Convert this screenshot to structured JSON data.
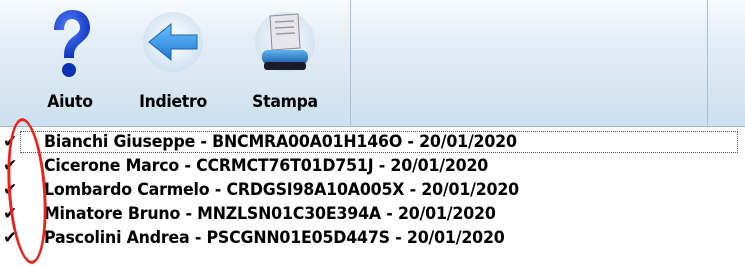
{
  "toolbar": {
    "help_label": "Aiuto",
    "back_label": "Indietro",
    "print_label": "Stampa"
  },
  "list": {
    "items": [
      {
        "checked": true,
        "label": "Bianchi Giuseppe - BNCMRA00A01H146O - 20/01/2020"
      },
      {
        "checked": true,
        "label": "Cicerone Marco - CCRMCT76T01D751J - 20/01/2020"
      },
      {
        "checked": true,
        "label": "Lombardo Carmelo - CRDGSI98A10A005X - 20/01/2020"
      },
      {
        "checked": true,
        "label": "Minatore Bruno - MNZLSN01C30E394A - 20/01/2020"
      },
      {
        "checked": true,
        "label": "Pascolini Andrea - PSCGNN01E05D447S - 20/01/2020"
      }
    ]
  },
  "check_glyph": "✔",
  "colors": {
    "annotation": "#e8231d",
    "toolbar_bg": "#cde0ee",
    "help_icon": "#1e4bd6",
    "back_icon": "#2a8fe0"
  }
}
